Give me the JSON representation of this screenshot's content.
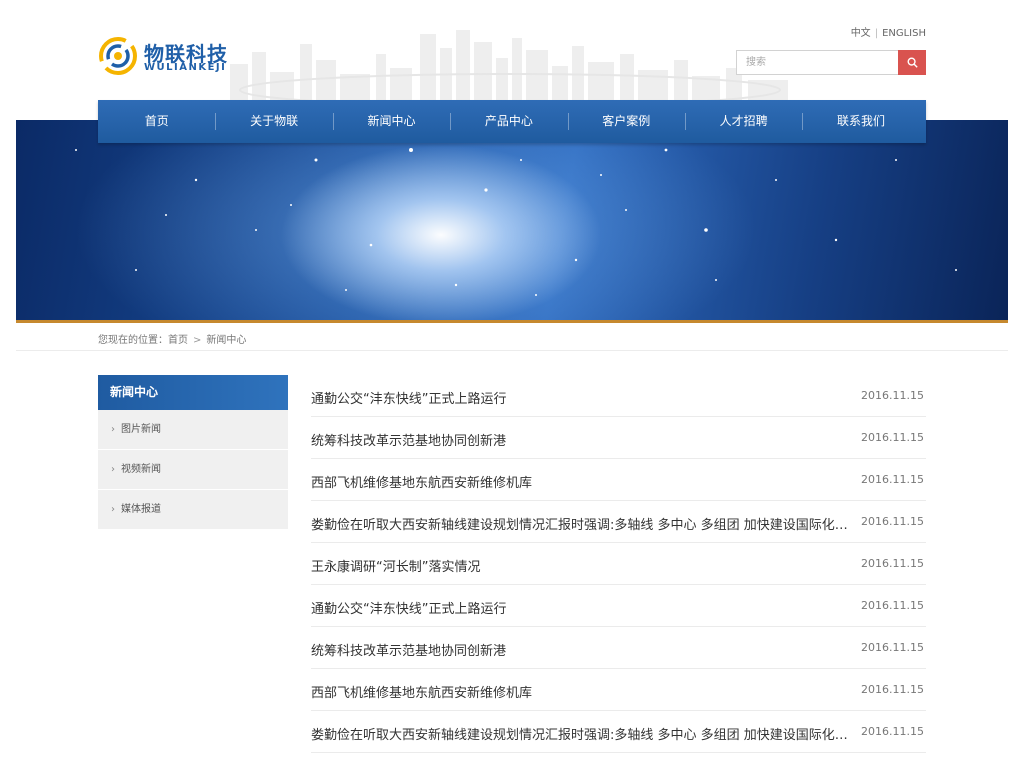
{
  "brand": {
    "name_cn": "物联科技",
    "name_en": "WULIANKEJI",
    "logo_icon": "swirl-logo-icon",
    "colors": {
      "primary": "#1f5fa8",
      "accent": "#f5b400",
      "search_button": "#d9534f",
      "banner_line": "#c6892f"
    }
  },
  "lang": {
    "cn": "中文",
    "separator": "|",
    "en": "ENGLISH"
  },
  "search": {
    "placeholder": "搜索",
    "icon": "search-icon"
  },
  "nav": {
    "items": [
      "首页",
      "关于物联",
      "新闻中心",
      "产品中心",
      "客户案例",
      "人才招聘",
      "联系我们"
    ]
  },
  "breadcrumb": {
    "label": "您现在的位置：",
    "home": "首页",
    "separator": ">",
    "current": "新闻中心"
  },
  "sidebar": {
    "title": "新闻中心",
    "items": [
      {
        "label": "图片新闻"
      },
      {
        "label": "视频新闻"
      },
      {
        "label": "媒体报道"
      }
    ]
  },
  "news": {
    "rows": [
      {
        "title": "通勤公交“沣东快线”正式上路运行",
        "date": "2016.11.15"
      },
      {
        "title": "统筹科技改革示范基地协同创新港",
        "date": "2016.11.15"
      },
      {
        "title": "西部飞机维修基地东航西安新维修机库",
        "date": "2016.11.15"
      },
      {
        "title": "娄勤俭在听取大西安新轴线建设规划情况汇报时强调:多轴线 多中心 多组团 加快建设国际化大都市",
        "date": "2016.11.15"
      },
      {
        "title": "王永康调研“河长制”落实情况",
        "date": "2016.11.15"
      },
      {
        "title": "通勤公交“沣东快线”正式上路运行",
        "date": "2016.11.15"
      },
      {
        "title": "统筹科技改革示范基地协同创新港",
        "date": "2016.11.15"
      },
      {
        "title": "西部飞机维修基地东航西安新维修机库",
        "date": "2016.11.15"
      },
      {
        "title": "娄勤俭在听取大西安新轴线建设规划情况汇报时强调:多轴线 多中心 多组团 加快建设国际化大都市",
        "date": "2016.11.15"
      }
    ]
  }
}
